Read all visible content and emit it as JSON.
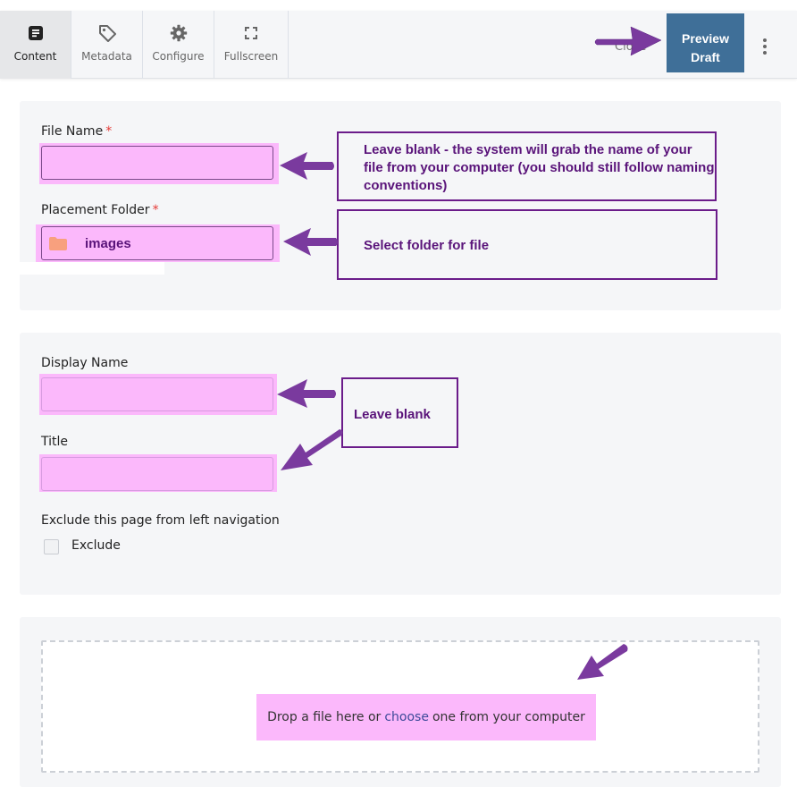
{
  "toolbar": {
    "tabs": [
      {
        "label": "Content",
        "icon": "document-icon",
        "active": true
      },
      {
        "label": "Metadata",
        "icon": "tag-icon",
        "active": false
      },
      {
        "label": "Configure",
        "icon": "gear-icon",
        "active": false
      },
      {
        "label": "Fullscreen",
        "icon": "fullscreen-icon",
        "active": false
      }
    ],
    "close_label": "Close",
    "preview_label_line1": "Preview",
    "preview_label_line2": "Draft",
    "more_icon": "kebab-menu-icon",
    "preview_color": "#3f6f98"
  },
  "section1": {
    "file_name_label": "File Name",
    "file_name_value": "",
    "placement_folder_label": "Placement Folder",
    "folder_icon": "folder-icon",
    "folder_value": "images",
    "required_marker": "*"
  },
  "section2": {
    "display_name_label": "Display Name",
    "display_name_value": "",
    "title_label": "Title",
    "title_value": "",
    "exclude_heading": "Exclude this page from left navigation",
    "exclude_checkbox_label": "Exclude",
    "exclude_checked": false
  },
  "upload": {
    "text_before": "Drop a file here or",
    "link_text": "choose",
    "text_after": "one from your computer"
  },
  "annotations": {
    "file_name_note": "Leave blank - the system will grab the name of your file from your computer (you should still follow naming conventions)",
    "folder_note": "Select folder for file",
    "display_title_note": "Leave blank",
    "arrow_color": "#7a3a9e",
    "highlight_color": "#fbb8fb",
    "callout_color": "#6b1c8a"
  }
}
